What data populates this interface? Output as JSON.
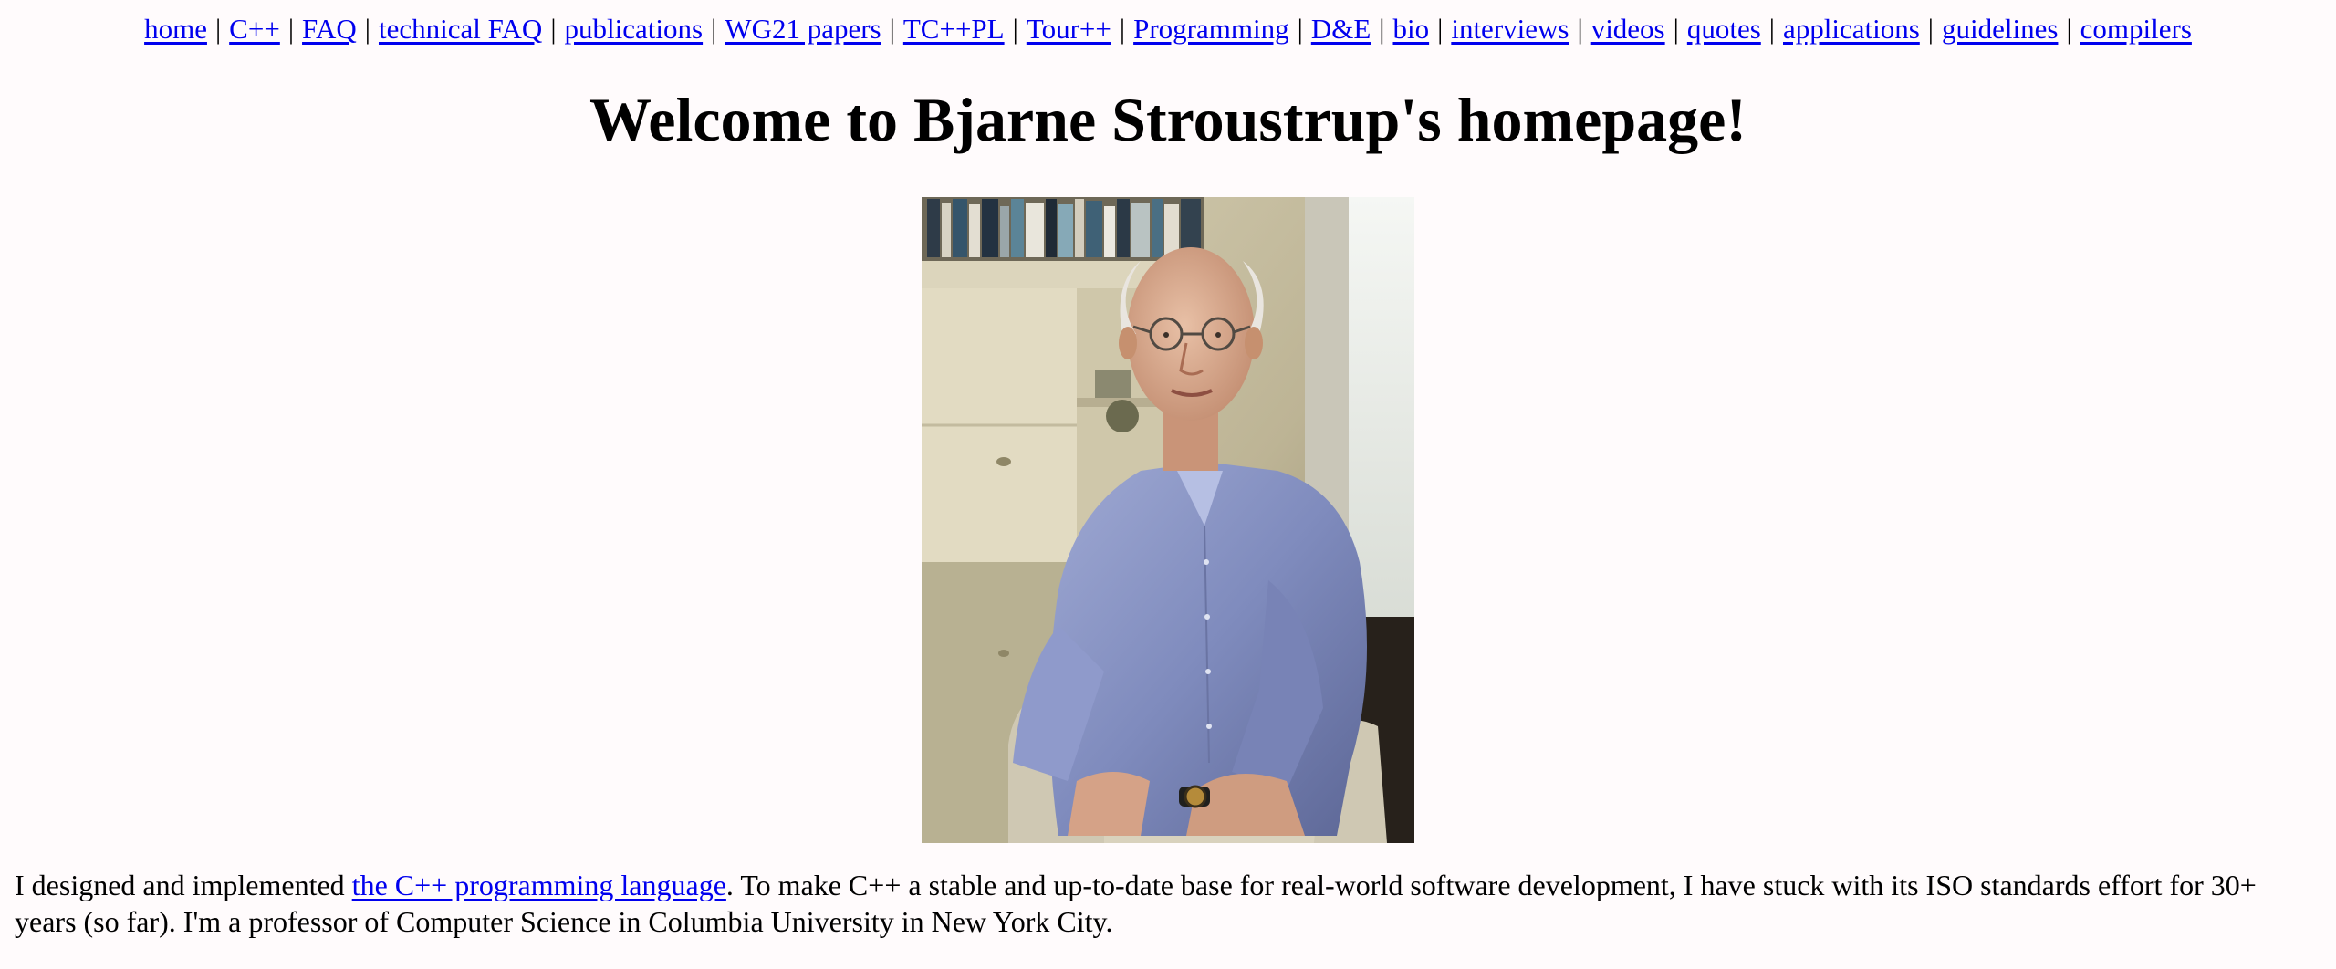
{
  "nav": {
    "links": [
      "home",
      "C++",
      "FAQ",
      "technical FAQ",
      "publications",
      "WG21 papers",
      "TC++PL",
      "Tour++",
      "Programming",
      "D&E",
      "bio",
      "interviews",
      "videos",
      "quotes",
      "applications",
      "guidelines",
      "compilers"
    ],
    "separator": "|"
  },
  "page": {
    "title": "Welcome to Bjarne Stroustrup's homepage!"
  },
  "intro": {
    "before_link": "I designed and implemented ",
    "link_text": "the C++ programming language",
    "after_link": ". To make C++ a stable and up-to-date base for real-world software development, I have stuck with its ISO standards effort for 30+ years (so far). I'm a professor of Computer Science in Columbia University in New York City."
  },
  "colors": {
    "background": "#fffbfc",
    "link": "#0000ee",
    "text": "#000000"
  }
}
